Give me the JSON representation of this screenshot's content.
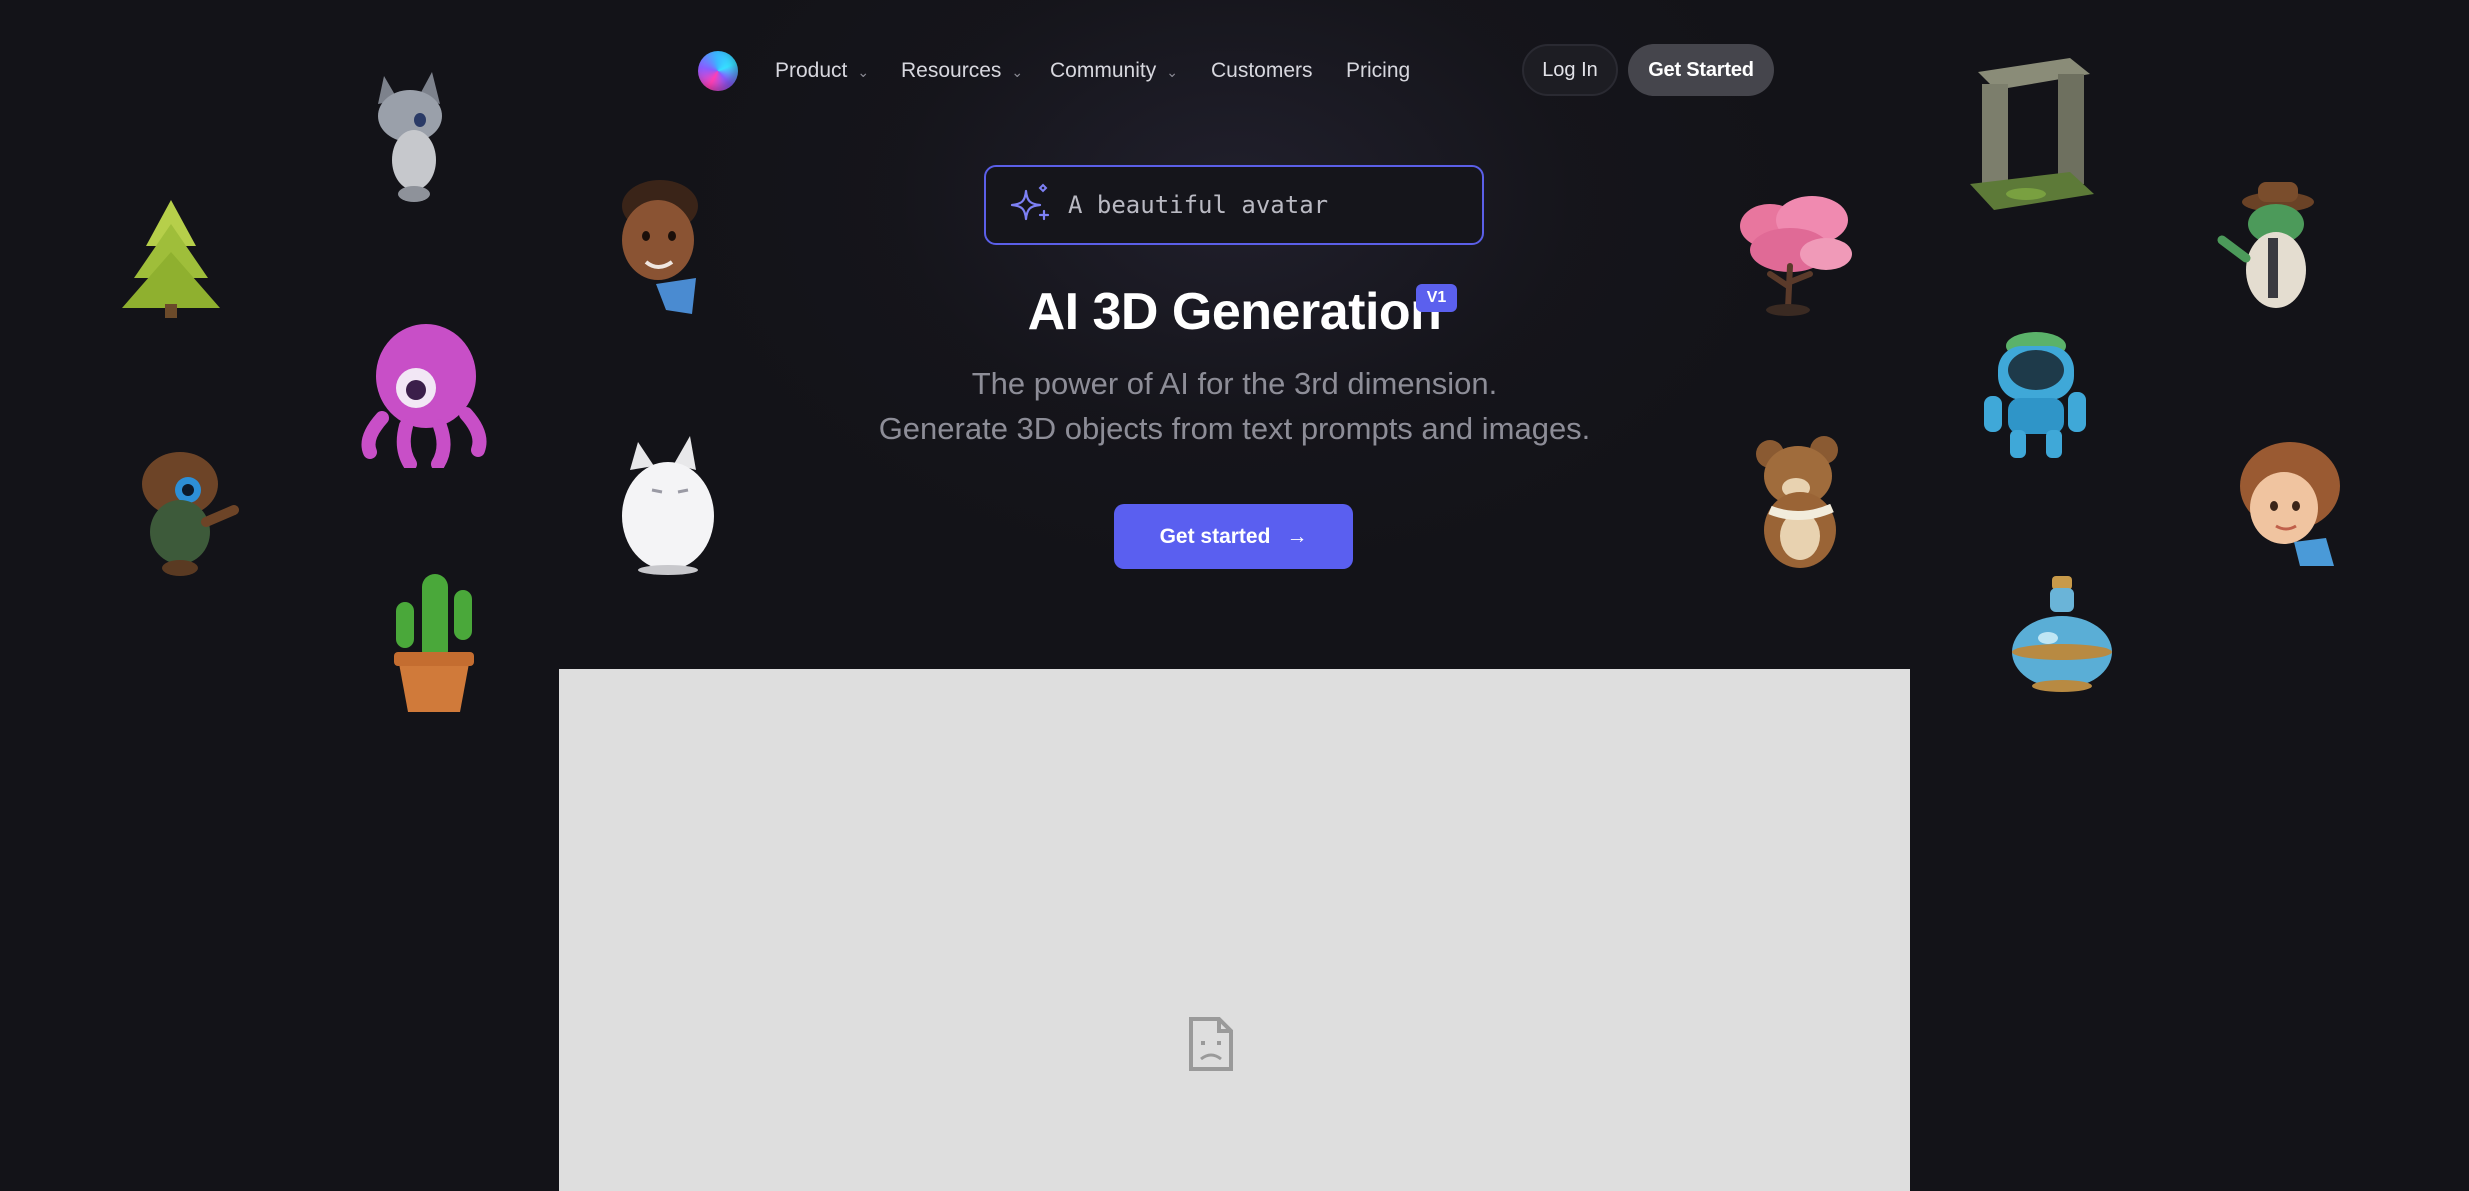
{
  "nav": {
    "logo_name": "brand-logo",
    "items": [
      {
        "label": "Product",
        "has_dropdown": true
      },
      {
        "label": "Resources",
        "has_dropdown": true
      },
      {
        "label": "Community",
        "has_dropdown": true
      },
      {
        "label": "Customers",
        "has_dropdown": false
      },
      {
        "label": "Pricing",
        "has_dropdown": false
      }
    ],
    "login_label": "Log In",
    "get_started_label": "Get Started"
  },
  "hero": {
    "prompt_text": "A beautiful avatar",
    "prompt_icon": "sparkles-icon",
    "title": "AI 3D Generation",
    "badge": "V1",
    "subtitle_line1": "The power of AI for the 3rd dimension.",
    "subtitle_line2": "Generate 3D objects from text prompts and images.",
    "cta_label": "Get started",
    "cta_arrow": "→"
  },
  "preview": {
    "icon": "broken-image-icon"
  },
  "colors": {
    "background": "#131318",
    "accent": "#5a5ff0",
    "prompt_border": "#5b5fe8",
    "preview_bg": "#dedede"
  }
}
